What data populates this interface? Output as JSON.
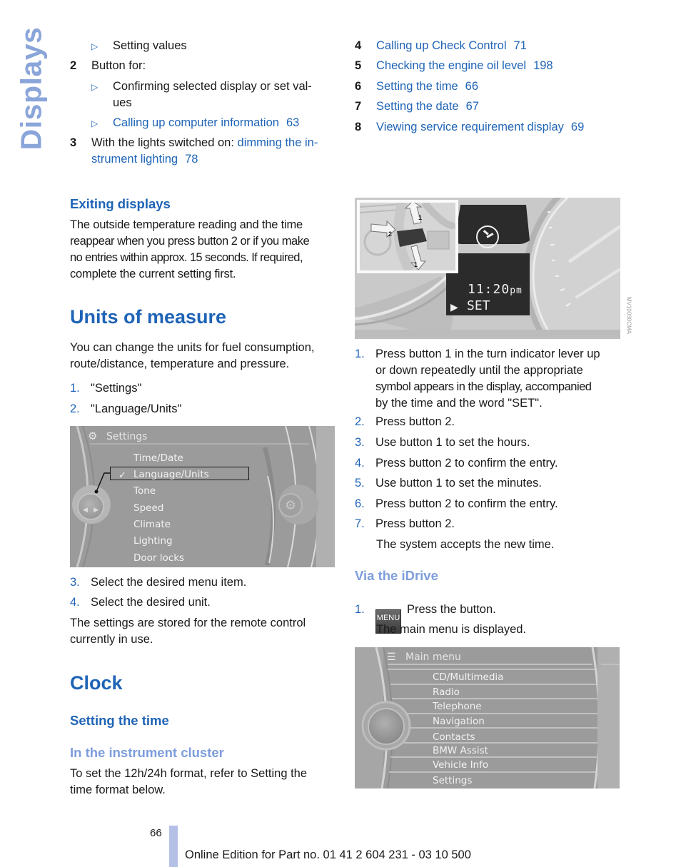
{
  "side_tab": "Displays",
  "left_top": {
    "sub_bullet_1": "Setting values",
    "item2_num": "2",
    "item2_label": "Button for:",
    "item2_bullets": [
      {
        "text": "Confirming selected display or set val-",
        "text2": "ues"
      },
      {
        "text": "Calling up computer information",
        "page": "63"
      }
    ],
    "item3_num": "3",
    "item3_text": "With the lights switched on:",
    "item3_link1": "dimming the in-",
    "item3_link2": "strument lighting",
    "item3_page": "78"
  },
  "right_top": {
    "items": [
      {
        "num": "4",
        "text": "Calling up Check Control",
        "page": "71"
      },
      {
        "num": "5",
        "text": "Checking the engine oil level",
        "page": "198"
      },
      {
        "num": "6",
        "text": "Setting the time",
        "page": "66"
      },
      {
        "num": "7",
        "text": "Setting the date",
        "page": "67"
      },
      {
        "num": "8",
        "text": "Viewing service requirement display",
        "page": "69"
      }
    ]
  },
  "exiting": {
    "heading": "Exiting displays",
    "lines": [
      "The outside temperature reading and the time",
      "reappear when you press button 2 or if you make",
      "no entries within approx. 15 seconds. If required,",
      "complete the current setting first."
    ]
  },
  "units": {
    "title": "Units of measure",
    "intro": [
      "You can change the units for fuel consumption,",
      "route/distance, temperature and pressure."
    ],
    "steps": [
      {
        "num": "1.",
        "text": "\"Settings\""
      },
      {
        "num": "2.",
        "text": "\"Language/Units\""
      }
    ],
    "screen": {
      "title": "Settings",
      "items": [
        "Time/Date",
        "Language/Units",
        "Tone",
        "Speed",
        "Climate",
        "Lighting",
        "Door locks"
      ],
      "selected": "Language/Units"
    },
    "steps2": [
      {
        "num": "3.",
        "text": "Select the desired menu item."
      },
      {
        "num": "4.",
        "text": "Select the desired unit."
      }
    ],
    "note": [
      "The settings are stored for the remote control",
      "currently in use."
    ]
  },
  "clock": {
    "title": "Clock",
    "sub": "Setting the time",
    "sub2": "In the instrument cluster",
    "para": [
      "To set the 12h/24h format, refer to Setting the",
      "time format below."
    ],
    "figure": {
      "time": "11:20",
      "ampm": "pm",
      "set": "SET",
      "label_1": "1",
      "label_2": "2",
      "code": "MV10030CMA"
    },
    "steps": [
      {
        "num": "1.",
        "lines": [
          "Press button 1 in the turn indicator lever up",
          "or down repeatedly until the appropriate",
          "symbol appears in the display, accompanied",
          "by the time and the word \"SET\"."
        ]
      },
      {
        "num": "2.",
        "lines": [
          "Press button 2."
        ]
      },
      {
        "num": "3.",
        "lines": [
          "Use button 1 to set the hours."
        ]
      },
      {
        "num": "4.",
        "lines": [
          "Press button 2 to confirm the entry."
        ]
      },
      {
        "num": "5.",
        "lines": [
          "Use button 1 to set the minutes."
        ]
      },
      {
        "num": "6.",
        "lines": [
          "Press button 2 to confirm the entry."
        ]
      },
      {
        "num": "7.",
        "lines": [
          "Press button 2."
        ]
      }
    ],
    "accepts": "The system accepts the new time.",
    "idrive": {
      "heading": "Via the iDrive",
      "step_num": "1.",
      "menu_btn": "MENU",
      "step_text": "Press the button.",
      "after": "The main menu is displayed.",
      "screen": {
        "title": "Main menu",
        "items": [
          "CD/Multimedia",
          "Radio",
          "Telephone",
          "Navigation",
          "Contacts",
          "BMW Assist",
          "Vehicle Info",
          "Settings"
        ]
      }
    }
  },
  "footer": {
    "page": "66",
    "text": "Online Edition for Part no. 01 41 2 604 231 - 03 10 500"
  }
}
